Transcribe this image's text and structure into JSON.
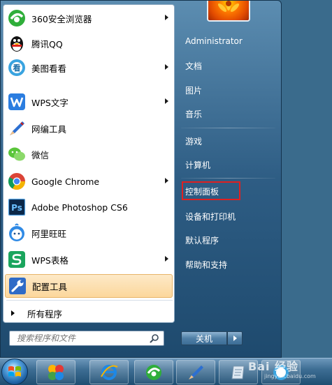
{
  "left_panel": {
    "apps": [
      {
        "label": "360安全浏览器",
        "icon": "360-browser-icon",
        "has_submenu": true
      },
      {
        "label": "腾讯QQ",
        "icon": "qq-penguin-icon",
        "has_submenu": false
      },
      {
        "label": "美图看看",
        "icon": "meitu-viewer-icon",
        "has_submenu": true
      },
      {
        "label": "WPS文字",
        "icon": "wps-writer-icon",
        "has_submenu": true
      },
      {
        "label": "网编工具",
        "icon": "pen-tool-icon",
        "has_submenu": false
      },
      {
        "label": "微信",
        "icon": "wechat-icon",
        "has_submenu": false
      },
      {
        "label": "Google Chrome",
        "icon": "chrome-icon",
        "has_submenu": true
      },
      {
        "label": "Adobe Photoshop CS6",
        "icon": "photoshop-icon",
        "has_submenu": false
      },
      {
        "label": "阿里旺旺",
        "icon": "aliwangwang-icon",
        "has_submenu": false
      },
      {
        "label": "WPS表格",
        "icon": "wps-spreadsheet-icon",
        "has_submenu": true
      },
      {
        "label": "配置工具",
        "icon": "wrench-icon",
        "has_submenu": false,
        "highlighted": true
      }
    ],
    "all_programs_label": "所有程序",
    "search_placeholder": "搜索程序和文件"
  },
  "right_panel": {
    "user_name": "Administrator",
    "items": [
      "文档",
      "图片",
      "音乐",
      "游戏",
      "计算机",
      "控制面板",
      "设备和打印机",
      "默认程序",
      "帮助和支持"
    ],
    "shutdown_label": "关机"
  },
  "watermark": {
    "text": "Bai 经验",
    "sub": "jingyan.baidu.com"
  },
  "colors": {
    "highlight_item": "#fcd79c",
    "annotation_box": "#e02020"
  }
}
